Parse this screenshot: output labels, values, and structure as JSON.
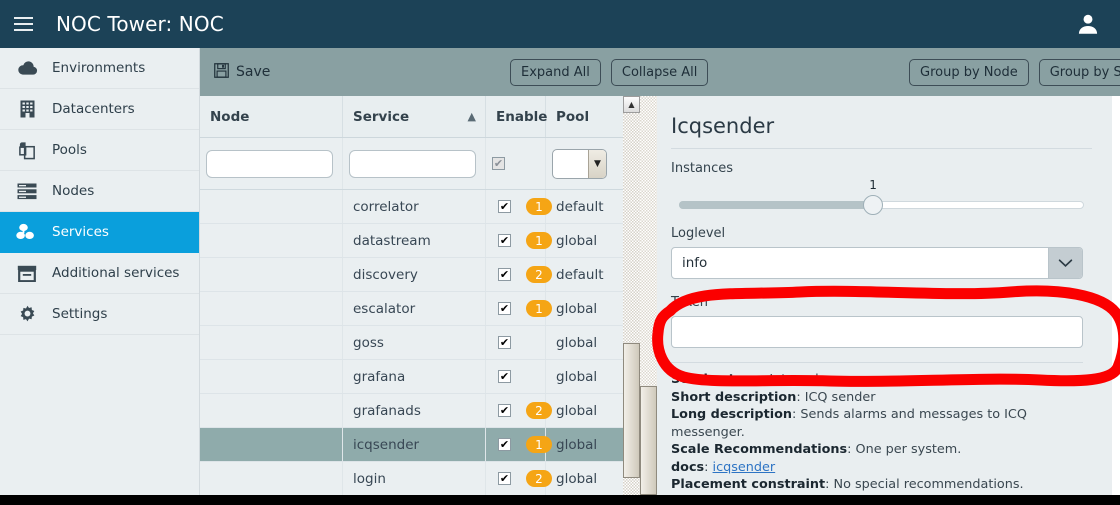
{
  "topbar": {
    "title": "NOC Tower: NOC",
    "menu_icon": "hamburger-icon",
    "user_icon": "user-avatar-icon"
  },
  "sidebar": {
    "items": [
      {
        "label": "Environments",
        "icon": "cloud-icon",
        "active": false
      },
      {
        "label": "Datacenters",
        "icon": "building-icon",
        "active": false
      },
      {
        "label": "Pools",
        "icon": "copy-icon",
        "active": false
      },
      {
        "label": "Nodes",
        "icon": "server-rack-icon",
        "active": false
      },
      {
        "label": "Services",
        "icon": "services-cubes-icon",
        "active": true
      },
      {
        "label": "Additional services",
        "icon": "archive-box-icon",
        "active": false
      },
      {
        "label": "Settings",
        "icon": "gear-icon",
        "active": false
      }
    ]
  },
  "toolbar": {
    "save_label": "Save",
    "save_icon": "floppy-disk-icon",
    "expand_all_label": "Expand All",
    "collapse_all_label": "Collapse All",
    "group_by_node_label": "Group by Node",
    "group_by_service_label": "Group by Service"
  },
  "grid": {
    "columns": [
      {
        "key": "node",
        "label": "Node",
        "sort": ""
      },
      {
        "key": "service",
        "label": "Service",
        "sort": "asc"
      },
      {
        "key": "enable",
        "label": "Enable",
        "sort": ""
      },
      {
        "key": "pool",
        "label": "Pool",
        "sort": ""
      }
    ],
    "filters": {
      "node_value": "",
      "service_value": "",
      "enable_checked": true,
      "pool_value": ""
    },
    "rows": [
      {
        "node": "",
        "service": "correlator",
        "enabled": true,
        "count": "1",
        "pool": "default",
        "selected": false
      },
      {
        "node": "",
        "service": "datastream",
        "enabled": true,
        "count": "1",
        "pool": "global",
        "selected": false
      },
      {
        "node": "",
        "service": "discovery",
        "enabled": true,
        "count": "2",
        "pool": "default",
        "selected": false
      },
      {
        "node": "",
        "service": "escalator",
        "enabled": true,
        "count": "1",
        "pool": "global",
        "selected": false
      },
      {
        "node": "",
        "service": "goss",
        "enabled": true,
        "count": "",
        "pool": "global",
        "selected": false
      },
      {
        "node": "",
        "service": "grafana",
        "enabled": true,
        "count": "",
        "pool": "global",
        "selected": false
      },
      {
        "node": "",
        "service": "grafanads",
        "enabled": true,
        "count": "2",
        "pool": "global",
        "selected": false
      },
      {
        "node": "",
        "service": "icqsender",
        "enabled": true,
        "count": "1",
        "pool": "global",
        "selected": true
      },
      {
        "node": "",
        "service": "login",
        "enabled": true,
        "count": "2",
        "pool": "global",
        "selected": false
      }
    ]
  },
  "detail": {
    "title": "Icqsender",
    "instances_label": "Instances",
    "instances_value": "1",
    "loglevel_label": "Loglevel",
    "loglevel_value": "info",
    "token_label": "Token",
    "token_value": "",
    "meta": [
      {
        "key": "Service type",
        "value": "Internal"
      },
      {
        "key": "Short description",
        "value": "ICQ sender"
      },
      {
        "key": "Long description",
        "value": "Sends alarms and messages to ICQ messenger."
      },
      {
        "key": "Scale Recommendations",
        "value": "One per system."
      },
      {
        "key": "docs",
        "value": "icqsender",
        "link": true
      },
      {
        "key": "Placement constraint",
        "value": "No special recommendations."
      }
    ]
  },
  "colors": {
    "topbar": "#1c4257",
    "sidebar_active": "#0a9fdc",
    "toolbar": "#89a0a2",
    "badge": "#f5a515",
    "row_selected": "#8fabab",
    "annotation": "#fb0000"
  }
}
